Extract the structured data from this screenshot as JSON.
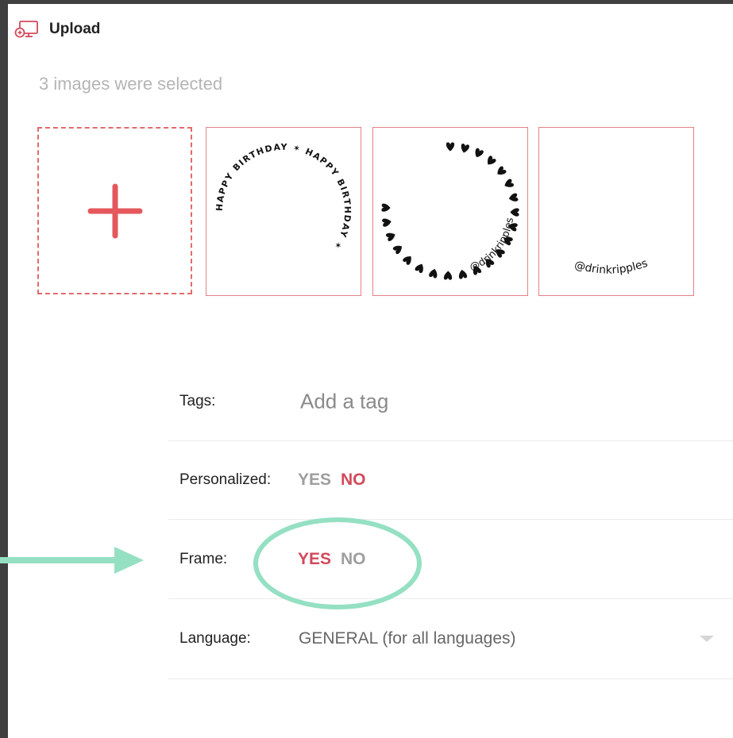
{
  "header": {
    "title": "Upload",
    "icon": "upload-monitor-icon"
  },
  "selection": {
    "count_text": "3 images were selected"
  },
  "add_tile": {
    "icon": "plus-icon"
  },
  "thumbnails": [
    {
      "name": "happy-birthday-ring",
      "ring_text": "HAPPY BIRTHDAY ✶ HAPPY BIRTHDAY ✶ "
    },
    {
      "name": "hearts-ring",
      "caption": "@drinkripples"
    },
    {
      "name": "drinkripples-text",
      "caption": "@drinkripples"
    }
  ],
  "form": {
    "tags": {
      "label": "Tags:",
      "placeholder": "Add a tag"
    },
    "personalized": {
      "label": "Personalized:",
      "yes": "YES",
      "no": "NO",
      "selected": "NO"
    },
    "frame": {
      "label": "Frame:",
      "yes": "YES",
      "no": "NO",
      "selected": "YES"
    },
    "language": {
      "label": "Language:",
      "value": "GENERAL (for all languages)"
    }
  },
  "colors": {
    "accent": "#d2495b",
    "inactive": "#9e9e9e",
    "tile_border": "#e48186",
    "annotation": "#95e0c3"
  }
}
